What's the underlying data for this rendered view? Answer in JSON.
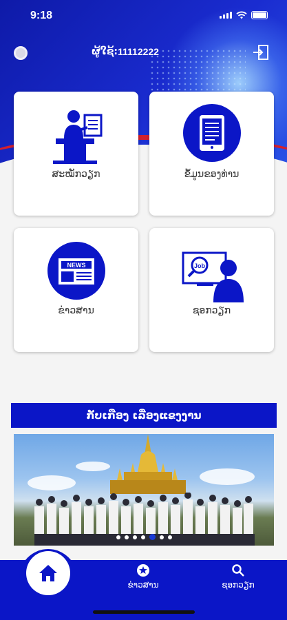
{
  "status_bar": {
    "time": "9:18"
  },
  "header": {
    "user_label": "ຜູ້ໃຊ້:",
    "user_id": "11112222"
  },
  "menu": {
    "cards": [
      {
        "label": "ສະໝັກວຽກ",
        "icon": "job-application-icon"
      },
      {
        "label": "ຂໍ້ມູນຂອງທ່ານ",
        "icon": "tablet-profile-icon"
      },
      {
        "label": "ຂ່າວສານ",
        "icon": "news-icon"
      },
      {
        "label": "ຊອກວຽກ",
        "icon": "job-search-icon"
      }
    ]
  },
  "banner": {
    "title": "ກັບເກືອງ ເລື່ອງແຂງງານ"
  },
  "carousel": {
    "slide_count": 7,
    "active_index": 4
  },
  "tabbar": {
    "home_icon": "home-icon",
    "news_label": "ຂ່າວສານ",
    "search_label": "ຊອກວຽກ"
  },
  "colors": {
    "primary": "#0b16c7",
    "accent_red": "#d2202e",
    "card_bg": "#ffffff"
  }
}
